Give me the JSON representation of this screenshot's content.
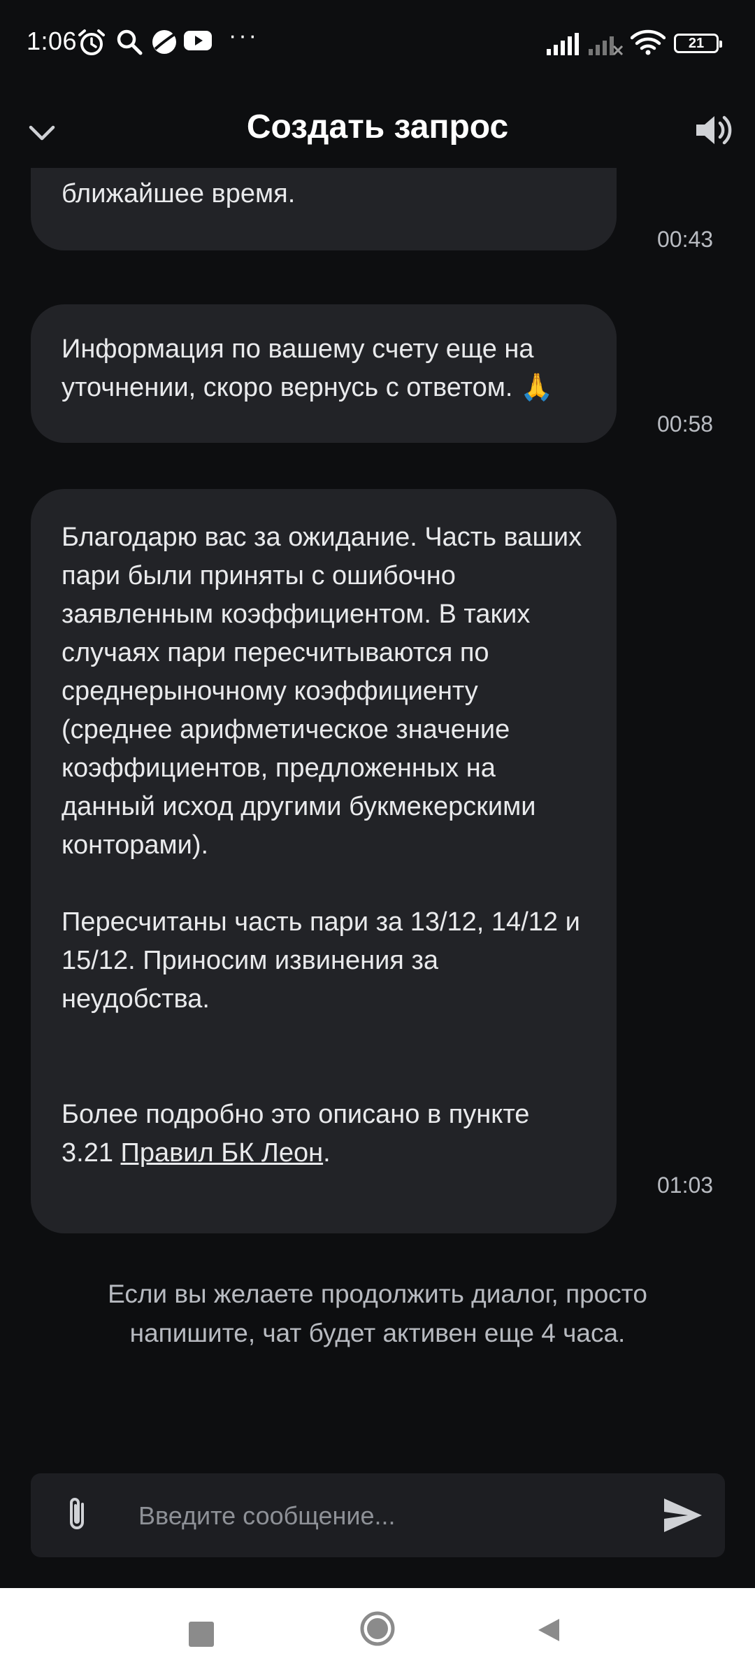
{
  "status_bar": {
    "time": "1:06",
    "battery_level": "21",
    "more_indicator": "···"
  },
  "header": {
    "title": "Создать запрос"
  },
  "messages": [
    {
      "paragraphs": [
        "ближайшее время."
      ],
      "time": "00:43"
    },
    {
      "paragraphs": [
        "Информация по вашему счету еще на уточнении, скоро вернусь с ответом. 🙏"
      ],
      "time": "00:58"
    },
    {
      "paragraphs": [
        "Благодарю вас за ожидание. Часть ваших пари были приняты с ошибочно заявленным коэффициентом. В таких случаях пари пересчитываются по среднерыночному коэффициенту (среднее арифметическое значение коэффициентов, предложенных на данный исход другими букмекерскими конторами).",
        "Пересчитаны часть пари за 13/12, 14/12 и 15/12. Приносим извинения за неудобства."
      ],
      "last_paragraph_prefix": "Более подробно это описано в пункте 3.21 ",
      "link_text": "Правил БК Леон",
      "last_paragraph_suffix": ".",
      "time": "01:03"
    }
  ],
  "info_note": "Если вы желаете продолжить диалог, просто напишите, чат будет активен еще 4 часа.",
  "composer": {
    "placeholder": "Введите сообщение..."
  },
  "icons": {
    "back": "chevron-down-icon",
    "sound": "speaker-icon",
    "attach": "paperclip-icon",
    "send": "send-icon"
  },
  "colors": {
    "background": "#0d0e10",
    "bubble": "#222327",
    "composer": "#1d1e22",
    "nav_bar": "#ffffff"
  }
}
